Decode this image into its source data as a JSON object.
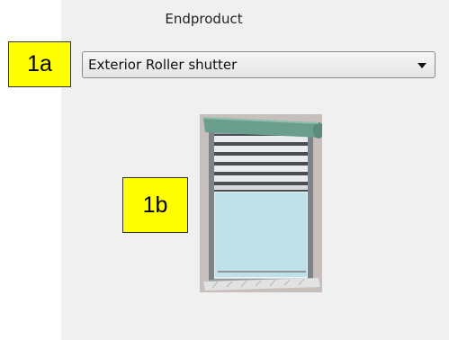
{
  "panel": {
    "title": "Endproduct"
  },
  "product_select": {
    "selected": "Exterior Roller shutter",
    "icon": "chevron-down-icon"
  },
  "callouts": {
    "a": "1a",
    "b": "1b"
  },
  "image": {
    "subject": "exterior roller shutter",
    "colors": {
      "wall": "#c7bfbc",
      "box": "#6a9e8d",
      "frame": "#9aa0a4",
      "glass": "#bfe1ea"
    }
  },
  "colors": {
    "panel_background": "#f0f0f0",
    "callout_fill": "#ffff00"
  }
}
